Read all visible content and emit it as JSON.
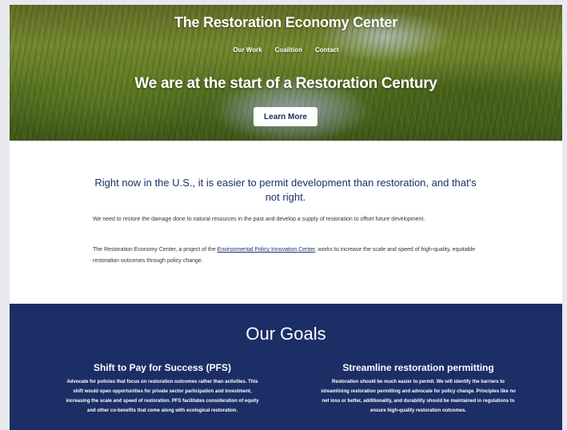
{
  "hero": {
    "site_title": "The Restoration Economy Center",
    "nav": [
      "Our Work",
      "Coalition",
      "Contact"
    ],
    "headline": "We are at the start of a Restoration Century",
    "button_label": "Learn More"
  },
  "intro": {
    "heading": "Right now in the U.S., it is easier to permit development than restoration, and that's not right.",
    "paragraph1": "We need to restore the damage done to natural resources in the past and develop a supply of restoration to offset future development.",
    "paragraph2_before": "The Restoration Economy Center, a project of the ",
    "paragraph2_link": "Environmental Policy Innovation Center",
    "paragraph2_after": ", works to increase the scale and speed of high-quality, equitable restoration outcomes through policy change."
  },
  "goals": {
    "title": "Our Goals",
    "items": [
      {
        "title": "Shift to Pay for Success (PFS)",
        "body": "Advocate for policies that focus on restoration outcomes rather than activities. This shift would open opportunities for private sector participation and investment, increasing the scale and speed of restoration. PFS facilitates consideration of equity and other co-benefits that come along with ecological restoration."
      },
      {
        "title": "Streamline restoration permitting",
        "body": "Restoration should be much easier to permit. We will identify the barriers to streamlining restoration permitting and advocate for policy change. Principles like no net loss or better, additionality, and durability should be maintained in regulations to ensure high-quality restoration outcomes."
      }
    ]
  },
  "colors": {
    "navy": "#1c2e66",
    "heading_blue": "#1c2f6b",
    "page_bg": "#e7e9ee"
  }
}
